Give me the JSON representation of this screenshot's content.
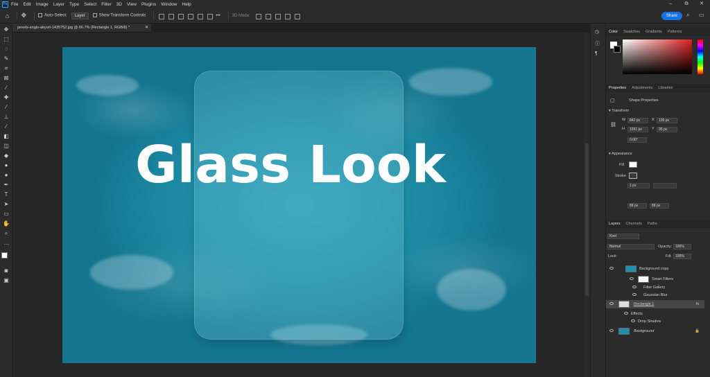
{
  "menu": [
    "File",
    "Edit",
    "Image",
    "Layer",
    "Type",
    "Select",
    "Filter",
    "3D",
    "View",
    "Plugins",
    "Window",
    "Help"
  ],
  "app_logo": "Ps",
  "window_controls": [
    "–",
    "⧉",
    "✕"
  ],
  "options": {
    "auto_select_label": "Auto-Select:",
    "auto_select_value": "Layer",
    "show_transform": "Show Transform Controls",
    "mode_3d": "3D Mode:"
  },
  "share_label": "Share",
  "document_tab": {
    "title": "pexels-engin-akyurt-1435752.jpg @ 66.7% (Rectangle 1, RGB/8) *",
    "close": "✕"
  },
  "canvas": {
    "headline": "Glass Look"
  },
  "color_panel": {
    "tabs": [
      "Color",
      "Swatches",
      "Gradients",
      "Patterns"
    ],
    "foreground": "#ffffff",
    "background": "#000000"
  },
  "properties_panel": {
    "tabs": [
      "Properties",
      "Adjustments",
      "Libraries"
    ],
    "subtitle": "Shape Properties",
    "transform_label": "Transform",
    "w_label": "W",
    "w": "842 px",
    "x_label": "X",
    "x": "139 px",
    "h_label": "H",
    "h": "1091 px",
    "y_label": "Y",
    "y": "95 px",
    "angle": "0.00°",
    "appearance_label": "Appearance",
    "fill_label": "Fill",
    "stroke_label": "Stroke",
    "stroke_width": "1 px",
    "radius_a": "88 px",
    "radius_b": "88 px"
  },
  "layers_panel": {
    "tabs": [
      "Layers",
      "Channels",
      "Paths"
    ],
    "kind": "Kind",
    "blend_mode": "Normal",
    "opacity_label": "Opacity:",
    "opacity": "100%",
    "lock_label": "Lock:",
    "fill_label": "Fill:",
    "fill": "100%",
    "layers": [
      {
        "name": "Background copy"
      },
      {
        "name": "Smart Filters"
      },
      {
        "name": "Filter Gallery"
      },
      {
        "name": "Gaussian Blur"
      },
      {
        "name": "Rectangle 1"
      },
      {
        "name": "Effects"
      },
      {
        "name": "Drop Shadow"
      },
      {
        "name": "Background"
      }
    ]
  }
}
